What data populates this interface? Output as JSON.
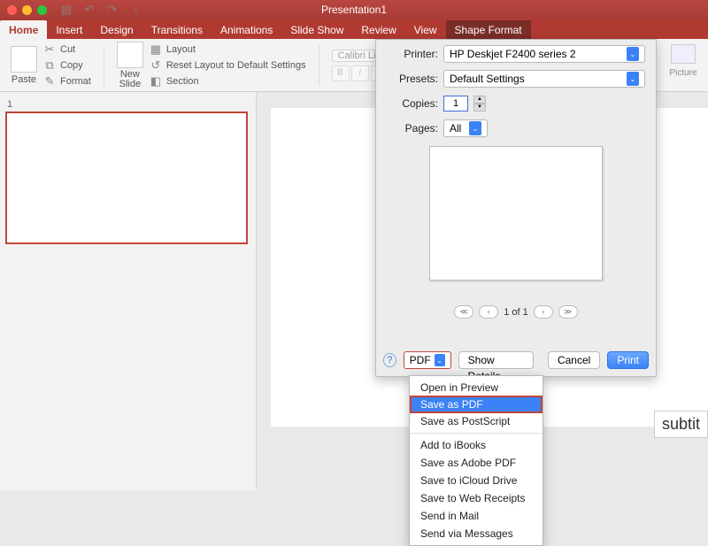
{
  "window": {
    "title": "Presentation1"
  },
  "tabs": {
    "items": [
      "Home",
      "Insert",
      "Design",
      "Transitions",
      "Animations",
      "Slide Show",
      "Review",
      "View",
      "Shape Format"
    ],
    "active": "Home",
    "context": "Shape Format"
  },
  "ribbon": {
    "paste": "Paste",
    "cut": "Cut",
    "copy": "Copy",
    "format": "Format",
    "newslide": "New\nSlide",
    "layout": "Layout",
    "reset": "Reset Layout to Default Settings",
    "section": "Section",
    "font_name": "Calibri Light (Headi…",
    "picture": "Picture"
  },
  "thumbs": {
    "num": "1"
  },
  "canvas": {
    "subtitle": "subtit"
  },
  "print": {
    "printer_label": "Printer:",
    "printer_value": "HP Deskjet F2400 series 2",
    "presets_label": "Presets:",
    "presets_value": "Default Settings",
    "copies_label": "Copies:",
    "copies_value": "1",
    "pages_label": "Pages:",
    "pages_value": "All",
    "page_indicator": "1 of 1",
    "help": "?",
    "pdf": "PDF",
    "show_details": "Show Details",
    "cancel": "Cancel",
    "print_btn": "Print"
  },
  "pdf_menu": {
    "items": [
      "Open in Preview",
      "Save as PDF",
      "Save as PostScript",
      "Add to iBooks",
      "Save as Adobe PDF",
      "Save to iCloud Drive",
      "Save to Web Receipts",
      "Send in Mail",
      "Send via Messages"
    ],
    "highlighted": "Save as PDF"
  }
}
